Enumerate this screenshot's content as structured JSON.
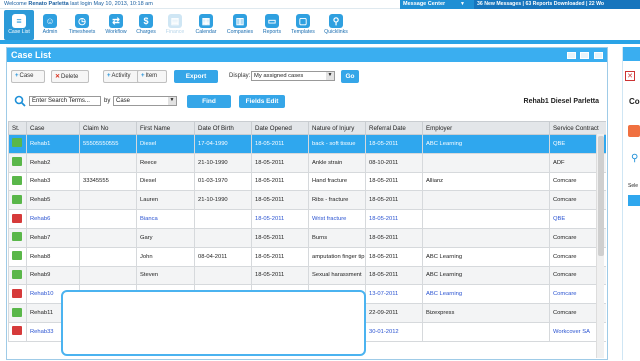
{
  "topbar": {
    "welcome_prefix": "Welcome",
    "user": "Renato Parletta",
    "last_login": "last login May 10, 2013, 10:18 am",
    "message_center": "Message Center",
    "stats": "36  New Messages  |  63  Reports Downloaded  |  22  Wo"
  },
  "nav": [
    {
      "label": "Case List",
      "icon": "case-list-icon",
      "glyph": "≡"
    },
    {
      "label": "Admin",
      "icon": "admin-icon",
      "glyph": "☺"
    },
    {
      "label": "Timesheets",
      "icon": "timesheets-icon",
      "glyph": "◷"
    },
    {
      "label": "Workflow",
      "icon": "workflow-icon",
      "glyph": "⇄"
    },
    {
      "label": "Charges",
      "icon": "charges-icon",
      "glyph": "$"
    },
    {
      "label": "Finance",
      "icon": "finance-icon",
      "glyph": "▤"
    },
    {
      "label": "Calendar",
      "icon": "calendar-icon",
      "glyph": "▦"
    },
    {
      "label": "Companies",
      "icon": "companies-icon",
      "glyph": "▥"
    },
    {
      "label": "Reports",
      "icon": "reports-icon",
      "glyph": "▭"
    },
    {
      "label": "Templates",
      "icon": "templates-icon",
      "glyph": "▢"
    },
    {
      "label": "Quicklinks",
      "icon": "quicklinks-icon",
      "glyph": "⚲"
    }
  ],
  "panel": {
    "title": "Case List"
  },
  "toolbar": {
    "case": "Case",
    "delete": "Delete",
    "activity": "Activity",
    "item": "Item",
    "export": "Export",
    "display_label": "Display:",
    "display_value": "My assigned cases",
    "go": "Go"
  },
  "search": {
    "placeholder": "Enter Search Terms...",
    "by_label": "by",
    "by_value": "Case",
    "find": "Find",
    "fields_edit": "Fields Edit",
    "context": "Rehab1 Diesel Parletta"
  },
  "table": {
    "columns": [
      "St.",
      "Case",
      "Claim No",
      "First Name",
      "Date Of Birth",
      "Date Opened",
      "Nature of Injury",
      "Referral Date",
      "Employer",
      "Service Contract"
    ],
    "rows": [
      {
        "status": "green",
        "cells": [
          "Rehab1",
          "55505550555",
          "Diesel",
          "17-04-1990",
          "18-05-2011",
          "back - soft tissue",
          "18-05-2011",
          "ABC Learning",
          "QBE"
        ]
      },
      {
        "status": "green",
        "cells": [
          "Rehab2",
          "",
          "Reece",
          "21-10-1990",
          "18-05-2011",
          "Ankle strain",
          "08-10-2011",
          "",
          "ADF"
        ]
      },
      {
        "status": "green",
        "cells": [
          "Rehab3",
          "33345555",
          "Diesel",
          "01-03-1970",
          "18-05-2011",
          "Hand fracture",
          "18-05-2011",
          "Allianz",
          "Comcare"
        ]
      },
      {
        "status": "green",
        "cells": [
          "Rehab5",
          "",
          "Lauren",
          "21-10-1990",
          "18-05-2011",
          "Ribs - fracture",
          "18-05-2011",
          "",
          "Comcare"
        ]
      },
      {
        "status": "red",
        "cells": [
          "Rehab6",
          "",
          "Bianca",
          "",
          "18-05-2011",
          "Wrist fracture",
          "18-05-2011",
          "",
          "QBE"
        ]
      },
      {
        "status": "green",
        "cells": [
          "Rehab7",
          "",
          "Gary",
          "",
          "18-05-2011",
          "Burns",
          "18-05-2011",
          "",
          "Comcare"
        ]
      },
      {
        "status": "green",
        "cells": [
          "Rehab8",
          "",
          "John",
          "08-04-2011",
          "18-05-2011",
          "amputation finger tip",
          "18-05-2011",
          "ABC Learning",
          "Comcare"
        ]
      },
      {
        "status": "green",
        "cells": [
          "Rehab9",
          "",
          "Steven",
          "",
          "18-05-2011",
          "Sexual harassment",
          "18-05-2011",
          "ABC Learning",
          "Comcare"
        ]
      },
      {
        "status": "red",
        "cells": [
          "Rehab10",
          "",
          "",
          "",
          "",
          "",
          "13-07-2011",
          "ABC Learning",
          "Comcare"
        ]
      },
      {
        "status": "green",
        "cells": [
          "Rehab11",
          "",
          "",
          "",
          "",
          "",
          "22-09-2011",
          "Bizexpress",
          "Comcare"
        ]
      },
      {
        "status": "red",
        "cells": [
          "Rehab33",
          "",
          "",
          "",
          "",
          "",
          "30-01-2012",
          "",
          "Workcover SA"
        ]
      }
    ]
  },
  "right_panel": {
    "letter_c": "Co",
    "letter_sel": "Sele"
  },
  "colors": {
    "accent": "#2fa7ee",
    "nav": "#2b9ad8",
    "status_green": "#5ab74a",
    "status_red": "#d63a3a",
    "link": "#2a53d1"
  }
}
